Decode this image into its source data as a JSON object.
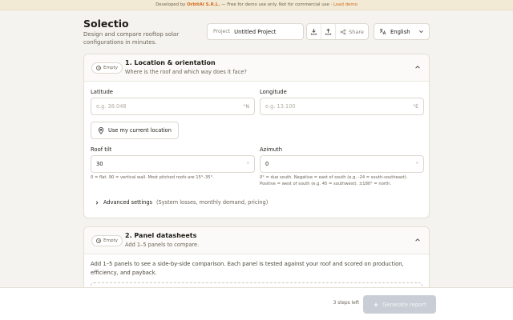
{
  "banner": {
    "prefix": "Developed by",
    "company": "OrbitAI S.R.L.",
    "note": "— Free for demo use only. Not for commercial use ·",
    "demo_link": "Load demo"
  },
  "header": {
    "title": "Solectio",
    "subtitle": "Design and compare rooftop solar configurations in minutes.",
    "project_label": "Project",
    "project_value": "Untitled Project",
    "share_label": "Share",
    "language": "English"
  },
  "section1": {
    "badge": "Empty",
    "title": "1. Location & orientation",
    "subtitle": "Where is the roof and which way does it face?",
    "latitude": {
      "label": "Latitude",
      "placeholder": "e.g. 38.048",
      "unit": "°N"
    },
    "longitude": {
      "label": "Longitude",
      "placeholder": "e.g. 13.100",
      "unit": "°E"
    },
    "location_button": "Use my current location",
    "tilt": {
      "label": "Roof tilt",
      "value": "30",
      "unit": "°",
      "hint": "0 = flat. 90 = vertical wall. Most pitched roofs are 15°–35°."
    },
    "azimuth": {
      "label": "Azimuth",
      "value": "0",
      "unit": "°",
      "hint_line1": "0° = due south. Negative = east of south (e.g. -24 = south-southeast).",
      "hint_line2": "Positive = west of south (e.g. 45 = southwest). ±180° = north."
    },
    "advanced_label": "Advanced settings",
    "advanced_extra": "(System losses, monthly demand, pricing)"
  },
  "section2": {
    "badge": "Empty",
    "title": "2. Panel datasheets",
    "subtitle": "Add 1–5 panels to compare.",
    "intro": "Add 1–5 panels to see a side-by-side comparison. Each panel is tested against your roof and scored on production, efficiency, and payback."
  },
  "footer": {
    "steps_left": "3 steps left",
    "generate_label": "Generate report"
  },
  "colors": {
    "background": "#f5f3ef",
    "accent": "#d2691e",
    "disabled_button": "#c9ced6"
  }
}
